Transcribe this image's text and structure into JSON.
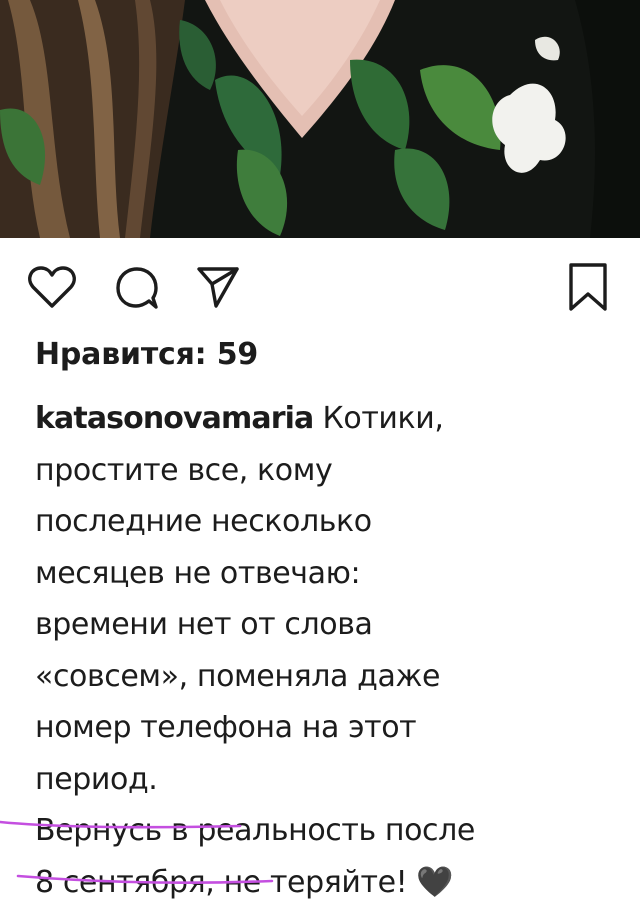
{
  "post": {
    "likes_label": "Нравится: 59",
    "username": "katasonovamaria",
    "caption_lines": [
      "Котики,",
      "простите все, кому",
      "последние несколько",
      "месяцев не отвечаю:",
      "времени нет от слова",
      "«совсем», поменяла даже",
      "номер телефона на этот",
      "период.",
      "Вернусь в реальность после",
      "8 сентября, не теряйте! 🖤"
    ]
  },
  "icons": {
    "like": "heart-icon",
    "comment": "comment-icon",
    "share": "share-icon",
    "save": "bookmark-icon"
  },
  "colors": {
    "text": "#1c1c1c",
    "underline_markup": "#c44fe0"
  }
}
